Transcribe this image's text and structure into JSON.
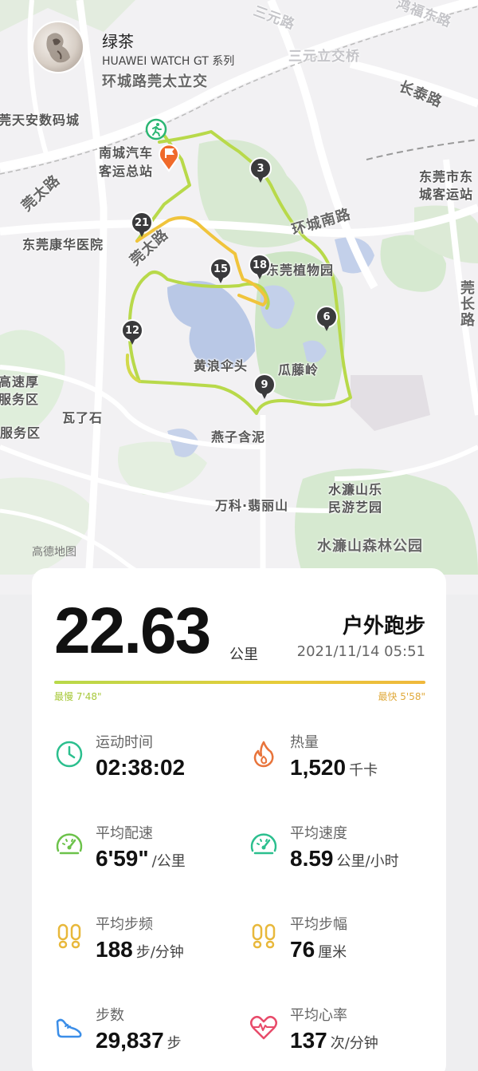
{
  "user": {
    "name": "绿茶",
    "device": "HUAWEI WATCH GT 系列"
  },
  "map": {
    "attribution": "高德地图",
    "labels": {
      "huanchenglu_guantai": "环城路莞太立交",
      "sanyuan_road": "三元路",
      "sanyuan_interchange": "三元立交桥",
      "changtai_road": "长泰路",
      "tianan_digital": "莞天安数码城",
      "nancheng_bus_1": "南城汽车",
      "nancheng_bus_2": "客运总站",
      "guantai_road": "莞太路",
      "dongguan_east_1": "东莞市东",
      "dongguan_east_2": "城客运站",
      "huancheng_south": "环城南路",
      "kanghua": "东莞康华医院",
      "guantai_road_2": "莞太路",
      "botanic": "东莞植物园",
      "guanchang_road": "莞长路",
      "huanglang": "黄浪伞头",
      "guatengling": "瓜藤岭",
      "expressway_1": "高速厚",
      "expressway_2": "服务区",
      "walashi": "瓦了石",
      "service_area": "服务区",
      "yanzi": "燕子含泥",
      "vanke": "万科·翡丽山",
      "shuilian_1": "水濂山乐",
      "shuilian_2": "民游艺园",
      "shuilian_forest": "水濂山森林公园",
      "hongfu_road": "鸿福东路"
    },
    "km_markers": [
      "3",
      "21",
      "15",
      "18",
      "6",
      "12",
      "9"
    ],
    "start_icon": "running-man-icon",
    "finish_icon": "finish-flag-icon",
    "route_colors": {
      "slow": "#b8d94a",
      "fast": "#f0b83c"
    }
  },
  "summary": {
    "distance": "22.63",
    "distance_unit": "公里",
    "activity_type": "户外跑步",
    "date": "2021/11/14 05:51",
    "pace_slowest": "最慢 7'48\"",
    "pace_fastest": "最快 5'58\""
  },
  "stats": [
    {
      "label": "运动时间",
      "value": "02:38:02",
      "unit": "",
      "icon": "clock-icon",
      "color": "#2bbf8e"
    },
    {
      "label": "热量",
      "value": "1,520",
      "unit": "千卡",
      "icon": "flame-icon",
      "color": "#e8743b"
    },
    {
      "label": "平均配速",
      "value": "6'59\"",
      "unit": "/公里",
      "icon": "speedometer-icon",
      "color": "#6cc24a"
    },
    {
      "label": "平均速度",
      "value": "8.59",
      "unit": "公里/小时",
      "icon": "speedometer-icon",
      "color": "#2bbf8e"
    },
    {
      "label": "平均步频",
      "value": "188",
      "unit": "步/分钟",
      "icon": "footprints-icon",
      "color": "#e8b83b"
    },
    {
      "label": "平均步幅",
      "value": "76",
      "unit": "厘米",
      "icon": "footprints-icon",
      "color": "#e8b83b"
    },
    {
      "label": "步数",
      "value": "29,837",
      "unit": "步",
      "icon": "shoe-icon",
      "color": "#3b8ee8"
    },
    {
      "label": "平均心率",
      "value": "137",
      "unit": "次/分钟",
      "icon": "heart-rate-icon",
      "color": "#e84b6a"
    }
  ]
}
